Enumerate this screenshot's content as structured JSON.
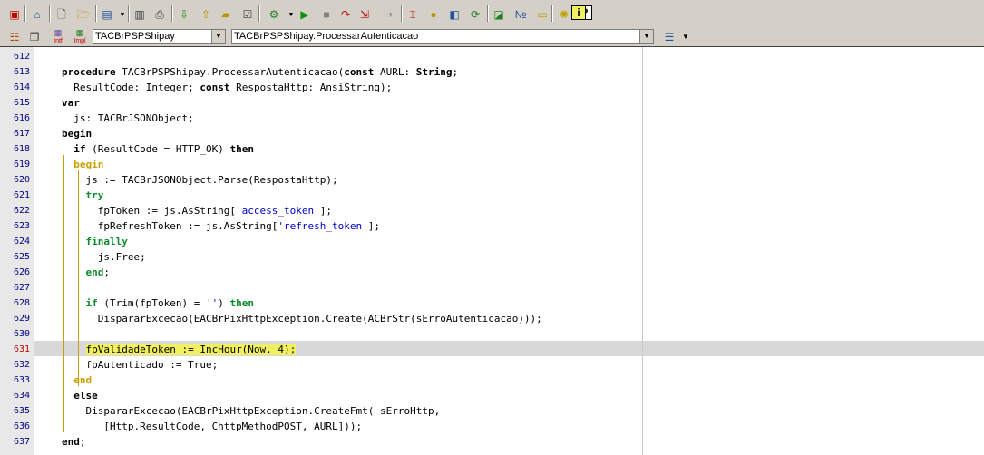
{
  "toolbar": {
    "icons": [
      "layout-icon",
      "home-icon",
      "new-file-icon",
      "open-file-icon",
      "run-project-icon",
      "save-icon",
      "print-icon",
      "import-icon",
      "export-icon",
      "folder-icon",
      "checklist-icon",
      "plugin-icon",
      "run-icon",
      "stop-icon",
      "step-icon",
      "step-into-icon",
      "step-over-icon",
      "trace-icon",
      "breakpoint-icon",
      "watch-icon",
      "sync-icon",
      "compile-icon",
      "numbers-icon",
      "notes-icon",
      "settings-icon",
      "help-icon",
      "info-icon"
    ]
  },
  "nav": {
    "class_selector": "TACBrPSPShipay",
    "method_selector": "TACBrPSPShipay.ProcessarAutenticacao",
    "intf_label": "Intf",
    "impl_label": "Impl"
  },
  "editor": {
    "highlight_color": "#f0f060",
    "current_line": "631",
    "lines": [
      {
        "n": "612",
        "tokens": []
      },
      {
        "n": "613",
        "tokens": [
          {
            "t": "procedure",
            "c": "kw"
          },
          {
            "t": " TACBrPSPShipay.ProcessarAutenticacao("
          },
          {
            "t": "const",
            "c": "kw"
          },
          {
            "t": " AURL: "
          },
          {
            "t": "String",
            "c": "kw"
          },
          {
            "t": ";"
          }
        ]
      },
      {
        "n": "614",
        "tokens": [
          {
            "t": "  ResultCode: Integer; "
          },
          {
            "t": "const",
            "c": "kw"
          },
          {
            "t": " RespostaHttp: AnsiString);"
          }
        ]
      },
      {
        "n": "615",
        "tokens": [
          {
            "t": "var",
            "c": "kw"
          }
        ]
      },
      {
        "n": "616",
        "tokens": [
          {
            "t": "  js: TACBrJSONObject;"
          }
        ]
      },
      {
        "n": "617",
        "tokens": [
          {
            "t": "begin",
            "c": "kw"
          }
        ]
      },
      {
        "n": "618",
        "tokens": [
          {
            "t": "  "
          },
          {
            "t": "if",
            "c": "kw"
          },
          {
            "t": " (ResultCode = HTTP_OK) "
          },
          {
            "t": "then",
            "c": "kw"
          }
        ]
      },
      {
        "n": "619",
        "tokens": [
          {
            "t": "  "
          },
          {
            "t": "begin",
            "c": "kw3"
          }
        ]
      },
      {
        "n": "620",
        "tokens": [
          {
            "t": "    js := TACBrJSONObject.Parse(RespostaHttp);"
          }
        ]
      },
      {
        "n": "621",
        "tokens": [
          {
            "t": "    "
          },
          {
            "t": "try",
            "c": "kw2"
          }
        ]
      },
      {
        "n": "622",
        "tokens": [
          {
            "t": "      fpToken := js.AsString["
          },
          {
            "t": "'access_token'",
            "c": "str"
          },
          {
            "t": "];"
          }
        ]
      },
      {
        "n": "623",
        "tokens": [
          {
            "t": "      fpRefreshToken := js.AsString["
          },
          {
            "t": "'refresh_token'",
            "c": "str"
          },
          {
            "t": "];"
          }
        ]
      },
      {
        "n": "624",
        "tokens": [
          {
            "t": "    "
          },
          {
            "t": "finally",
            "c": "kw2"
          }
        ]
      },
      {
        "n": "625",
        "tokens": [
          {
            "t": "      js.Free;"
          }
        ]
      },
      {
        "n": "626",
        "tokens": [
          {
            "t": "    "
          },
          {
            "t": "end",
            "c": "kw2"
          },
          {
            "t": ";"
          }
        ]
      },
      {
        "n": "627",
        "tokens": []
      },
      {
        "n": "628",
        "tokens": [
          {
            "t": "    "
          },
          {
            "t": "if",
            "c": "kw2"
          },
          {
            "t": " (Trim(fpToken) = "
          },
          {
            "t": "''",
            "c": "str"
          },
          {
            "t": ") "
          },
          {
            "t": "then",
            "c": "kw2"
          }
        ]
      },
      {
        "n": "629",
        "tokens": [
          {
            "t": "      DispararExcecao(EACBrPixHttpException.Create(ACBrStr(sErroAutenticacao)));"
          }
        ]
      },
      {
        "n": "630",
        "tokens": []
      },
      {
        "n": "631",
        "tokens": [
          {
            "t": "    "
          },
          {
            "t": "fpValidadeToken := IncHour(Now, 4);",
            "c": "hl"
          }
        ]
      },
      {
        "n": "632",
        "tokens": [
          {
            "t": "    fpAutenticado := True;"
          }
        ]
      },
      {
        "n": "633",
        "tokens": [
          {
            "t": "  "
          },
          {
            "t": "end",
            "c": "kw3"
          }
        ]
      },
      {
        "n": "634",
        "tokens": [
          {
            "t": "  "
          },
          {
            "t": "else",
            "c": "kw"
          }
        ]
      },
      {
        "n": "635",
        "tokens": [
          {
            "t": "    DispararExcecao(EACBrPixHttpException.CreateFmt( sErroHttp,"
          }
        ]
      },
      {
        "n": "636",
        "tokens": [
          {
            "t": "       [Http.ResultCode, ChttpMethodPOST, AURL]));"
          }
        ]
      },
      {
        "n": "637",
        "tokens": [
          {
            "t": "end",
            "c": "kw"
          },
          {
            "t": ";"
          }
        ]
      }
    ]
  }
}
